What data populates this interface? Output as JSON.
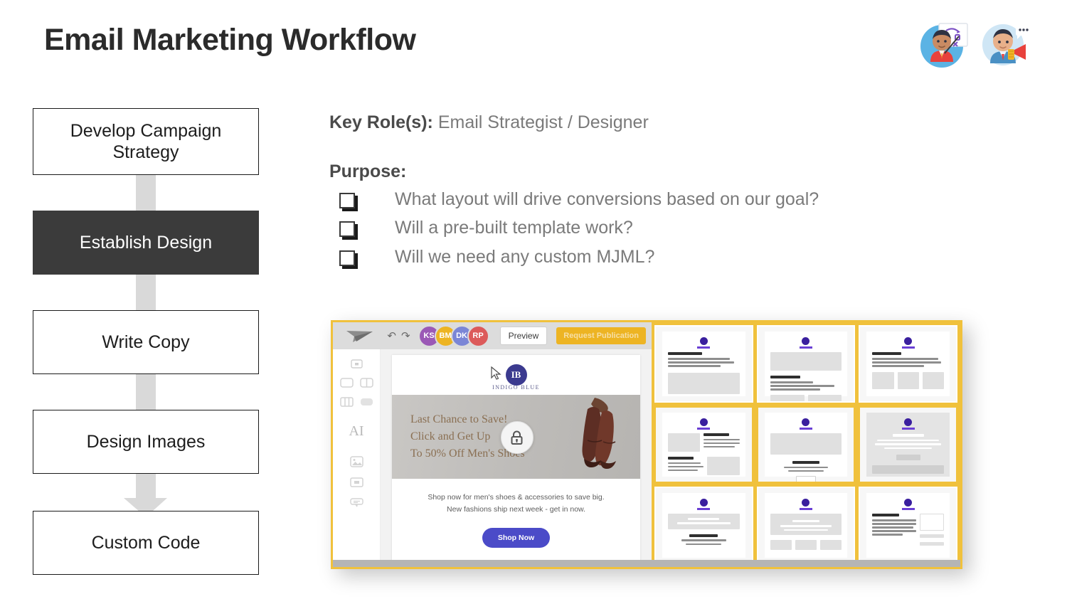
{
  "slide": {
    "title": "Email Marketing Workflow"
  },
  "header_illustrations": [
    {
      "name": "strategist-whiteboard-avatar",
      "alt": "Person pointing at a strategy whiteboard"
    },
    {
      "name": "marketer-megaphone-avatar",
      "alt": "Person holding a megaphone"
    }
  ],
  "flowchart": {
    "steps": [
      {
        "label": "Develop Campaign Strategy",
        "active": false
      },
      {
        "label": "Establish Design",
        "active": true
      },
      {
        "label": "Write Copy",
        "active": false
      },
      {
        "label": "Design Images",
        "active": false
      },
      {
        "label": "Custom Code",
        "active": false
      }
    ],
    "connector_color": "#d9d9d9",
    "active_color": "#3b3b3b"
  },
  "content": {
    "key_roles_label": "Key Role(s):",
    "key_roles_value": "Email Strategist / Designer",
    "purpose_label": "Purpose:",
    "bullets": [
      "What layout will drive conversions based on our goal?",
      "Will a pre-built template work?",
      "Will we need any custom MJML?"
    ]
  },
  "app_screenshot": {
    "frame_accent_color": "#f0c13c",
    "toolbar": {
      "logo_name": "paper-plane-logo",
      "undo_label": "↶",
      "redo_label": "↷",
      "avatars": [
        {
          "initials": "KS",
          "color": "#9b59b6"
        },
        {
          "initials": "BM",
          "color": "#edb423"
        },
        {
          "initials": "DK",
          "color": "#7b86d6"
        },
        {
          "initials": "RP",
          "color": "#dc5a5a"
        }
      ],
      "preview_label": "Preview",
      "publish_label": "Request Publication"
    },
    "tool_rail": [
      "settings-icon",
      "one-column-icon",
      "two-column-icon",
      "three-column-icon",
      "full-width-icon",
      "ai-text-icon",
      "image-icon",
      "button-icon",
      "social-icon"
    ],
    "ai_label": "AI",
    "email": {
      "brand_mark": "IB",
      "brand_name": "INDIGO BLUE",
      "hero_lines": [
        "Last Chance to Save!",
        "Click and Get Up",
        "To 50% Off Men's Shoes"
      ],
      "hero_lock_icon": "lock-icon",
      "body_lines": [
        "Shop now for men's shoes & accessories to save big.",
        "New fashions ship next week - get in now."
      ],
      "cta_label": "Shop Now",
      "cta_color": "#4b4bc8"
    },
    "gallery": {
      "label": "template-gallery",
      "selected_row": 2,
      "templates": [
        {
          "id": "tpl-1",
          "layout": "header-text-block",
          "selected": false
        },
        {
          "id": "tpl-2",
          "layout": "hero-text-two-buttons",
          "selected": false
        },
        {
          "id": "tpl-3",
          "layout": "text-three-columns",
          "selected": false
        },
        {
          "id": "tpl-4",
          "layout": "image-left-text-right",
          "selected": true
        },
        {
          "id": "tpl-5",
          "layout": "hero-centered-cta",
          "selected": true
        },
        {
          "id": "tpl-6",
          "layout": "inverted-hero-cta",
          "selected": true
        },
        {
          "id": "tpl-7",
          "layout": "banner-text",
          "selected": false
        },
        {
          "id": "tpl-8",
          "layout": "banner-three-blocks",
          "selected": false
        },
        {
          "id": "tpl-9",
          "layout": "text-sidebar",
          "selected": false
        }
      ]
    }
  }
}
